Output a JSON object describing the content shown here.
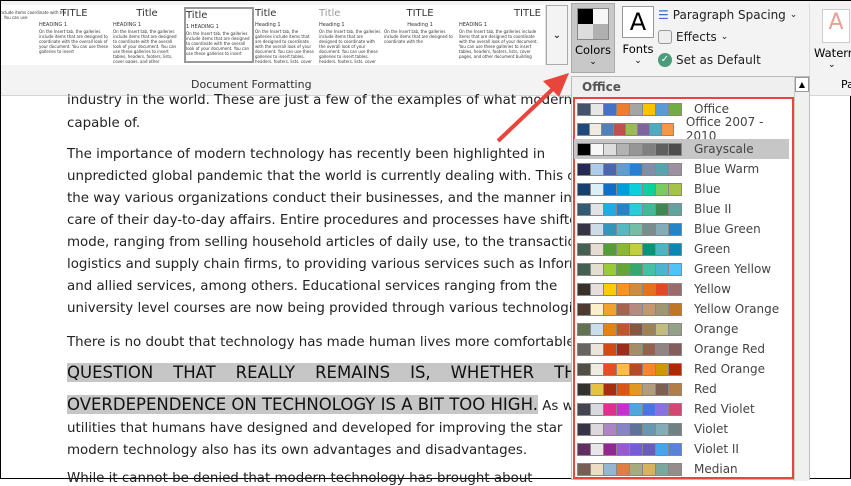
{
  "ribbon": {
    "styles": [
      {
        "title": "",
        "heading": "",
        "body": "galleries include items coordinate with the document. You can use"
      },
      {
        "title": "TITLE",
        "heading": "HEADING 1",
        "body": "On the Insert tab, the galleries include items that are designed to coordinate with the overall look of your document. You can use these galleries to insert"
      },
      {
        "title": "Title",
        "heading": "HEADING 1",
        "body": "On the Insert tab, the galleries include items that are designed to coordinate with the overall look of your document. You can use these galleries to insert tables, headers, footers, lists, cover pages, and other"
      },
      {
        "title": "Title",
        "heading": "1  HEADING 1",
        "body": "On the Insert tab, the galleries include items that are designed to coordinate with the overall look of your document. You can use these galleries to insert"
      },
      {
        "title": "Title",
        "heading": "Heading 1",
        "body": "On the Insert tab, the galleries include items that are designed to coordinate with the overall look of your document. You can use these galleries to insert tables, headers, footers, lists, cover pages,"
      },
      {
        "title": "Title",
        "heading": "Heading 1",
        "body": "On the Insert tab, the galleries include items that are designed to coordinate with the overall look of your document. You can use these galleries to insert tables, headers, footers, lists, cover pages,"
      },
      {
        "title": "TITLE",
        "heading": "Heading 1",
        "body": "On the Insert tab, the galleries include items that are designed to coordinate with the"
      },
      {
        "title": "TITLE",
        "heading": "HEADING 1",
        "body": "On the Insert tab, the galleries include items that are designed to coordinate with the overall look of your document. You can use these galleries to insert tables, headers, footers, lists, cover pages, and other document building"
      }
    ],
    "group_label": "Document Formatting",
    "colors_label": "Colors",
    "fonts_label": "Fonts",
    "fonts_glyph": "A",
    "paragraph_spacing": "Paragraph Spacing",
    "effects": "Effects",
    "set_default": "Set as Default",
    "watermark": "Waterm",
    "page_group": "Pa"
  },
  "document": {
    "lines": [
      "industry in the world. These are just a few of the examples of what modern",
      "capable of.",
      "The importance of modern technology has recently been highlighted in",
      "unpredicted global pandemic that the world is currently dealing with. This crisis",
      "the way various organizations conduct their businesses, and the manner in whi",
      "care of their day-to-day affairs. Entire procedures and processes have shifte",
      "mode, ranging from selling household articles of daily use, to the transaction",
      "logistics and supply chain firms, to providing various services such as Informat",
      "and allied services, among others. Educational services ranging from the",
      "university level courses are now being provided through various technological",
      "There is no doubt that technology has made human lives more comfortable",
      "QUESTION THAT REALLY REMAINS IS, WHETHER THE",
      "OVERDEPENDENCE ON TECHNOLOGY IS A BIT TOO HIGH.",
      "As wit",
      "utilities that humans have designed and developed for improving the star",
      "modern technology also has its own advantages and disadvantages.",
      "While it cannot be denied that modern technology has brought about"
    ]
  },
  "colors_menu": {
    "header": "Office",
    "selected": "Grayscale",
    "themes": [
      {
        "name": "Office",
        "colors": [
          "#44546a",
          "#e7e6e6",
          "#4472c4",
          "#ed7d31",
          "#a5a5a5",
          "#ffc000",
          "#5b9bd5",
          "#70ad47"
        ]
      },
      {
        "name": "Office 2007 - 2010",
        "colors": [
          "#1f497d",
          "#eeece1",
          "#4f81bd",
          "#c0504d",
          "#9bbb59",
          "#8064a2",
          "#4bacc6",
          "#f79646"
        ]
      },
      {
        "name": "Grayscale",
        "colors": [
          "#000000",
          "#f8f8f8",
          "#dddddd",
          "#b2b2b2",
          "#969696",
          "#808080",
          "#5f5f5f",
          "#4d4d4d"
        ]
      },
      {
        "name": "Blue Warm",
        "colors": [
          "#242852",
          "#acccea",
          "#4a66ac",
          "#629dd1",
          "#297fd5",
          "#7f8fa9",
          "#5aa2ae",
          "#9d90a0"
        ]
      },
      {
        "name": "Blue",
        "colors": [
          "#17406d",
          "#dbeff9",
          "#0f6fc6",
          "#009dd9",
          "#0bd0d9",
          "#10cf9b",
          "#7cca62",
          "#a5c249"
        ]
      },
      {
        "name": "Blue II",
        "colors": [
          "#335b74",
          "#dfe3e5",
          "#1cade4",
          "#2683c6",
          "#27ced7",
          "#42ba97",
          "#3e8853",
          "#62a39f"
        ]
      },
      {
        "name": "Blue Green",
        "colors": [
          "#373545",
          "#cedbe6",
          "#3494ba",
          "#58b6c0",
          "#75bda7",
          "#7a8c8e",
          "#84acb6",
          "#2683c6"
        ]
      },
      {
        "name": "Green",
        "colors": [
          "#455f51",
          "#e3ded1",
          "#549e39",
          "#8ab833",
          "#c0cf3a",
          "#029676",
          "#4ab5c4",
          "#0989b1"
        ]
      },
      {
        "name": "Green Yellow",
        "colors": [
          "#455f51",
          "#e3ded1",
          "#99cb38",
          "#63a537",
          "#37a76f",
          "#44c1a3",
          "#4eb3cf",
          "#51c3f9"
        ]
      },
      {
        "name": "Yellow",
        "colors": [
          "#39302a",
          "#e5dedb",
          "#ffca08",
          "#f8931d",
          "#ce8d3e",
          "#ec7016",
          "#e64823",
          "#9c6a6a"
        ]
      },
      {
        "name": "Yellow Orange",
        "colors": [
          "#4e3b30",
          "#fbeec9",
          "#f0a22e",
          "#a5644e",
          "#b58b80",
          "#c3986d",
          "#a19574",
          "#c17529"
        ]
      },
      {
        "name": "Orange",
        "colors": [
          "#637052",
          "#ccddea",
          "#e48312",
          "#bd582c",
          "#865640",
          "#9b8357",
          "#c2bc80",
          "#94a088"
        ]
      },
      {
        "name": "Orange Red",
        "colors": [
          "#696464",
          "#e9e5dc",
          "#d34817",
          "#9b2d1f",
          "#a28e6a",
          "#956251",
          "#918485",
          "#855d5d"
        ]
      },
      {
        "name": "Red Orange",
        "colors": [
          "#505046",
          "#eeece1",
          "#e84c22",
          "#ffbd47",
          "#b64926",
          "#ff8427",
          "#cc9900",
          "#b22600"
        ]
      },
      {
        "name": "Red",
        "colors": [
          "#323232",
          "#e5c243",
          "#a5300f",
          "#d55816",
          "#e19825",
          "#b19c7d",
          "#7f5f52",
          "#b27d49"
        ]
      },
      {
        "name": "Red Violet",
        "colors": [
          "#454551",
          "#d8d9dc",
          "#e32d91",
          "#c830cc",
          "#4ea6dc",
          "#4775e7",
          "#8971e1",
          "#d54773"
        ]
      },
      {
        "name": "Violet",
        "colors": [
          "#373545",
          "#dcd8dc",
          "#ad84c6",
          "#8784c7",
          "#5d739a",
          "#6997af",
          "#84acb6",
          "#6f8183"
        ]
      },
      {
        "name": "Violet II",
        "colors": [
          "#632e62",
          "#eae5eb",
          "#92278f",
          "#9b57d3",
          "#755dd9",
          "#665eb8",
          "#45a5ed",
          "#5982db"
        ]
      },
      {
        "name": "Median",
        "colors": [
          "#775f55",
          "#ebddc3",
          "#94b6d2",
          "#dd8047",
          "#a5ab81",
          "#d8b25c",
          "#7ba79d",
          "#968c8c"
        ]
      }
    ]
  },
  "accent": "#e8453c"
}
